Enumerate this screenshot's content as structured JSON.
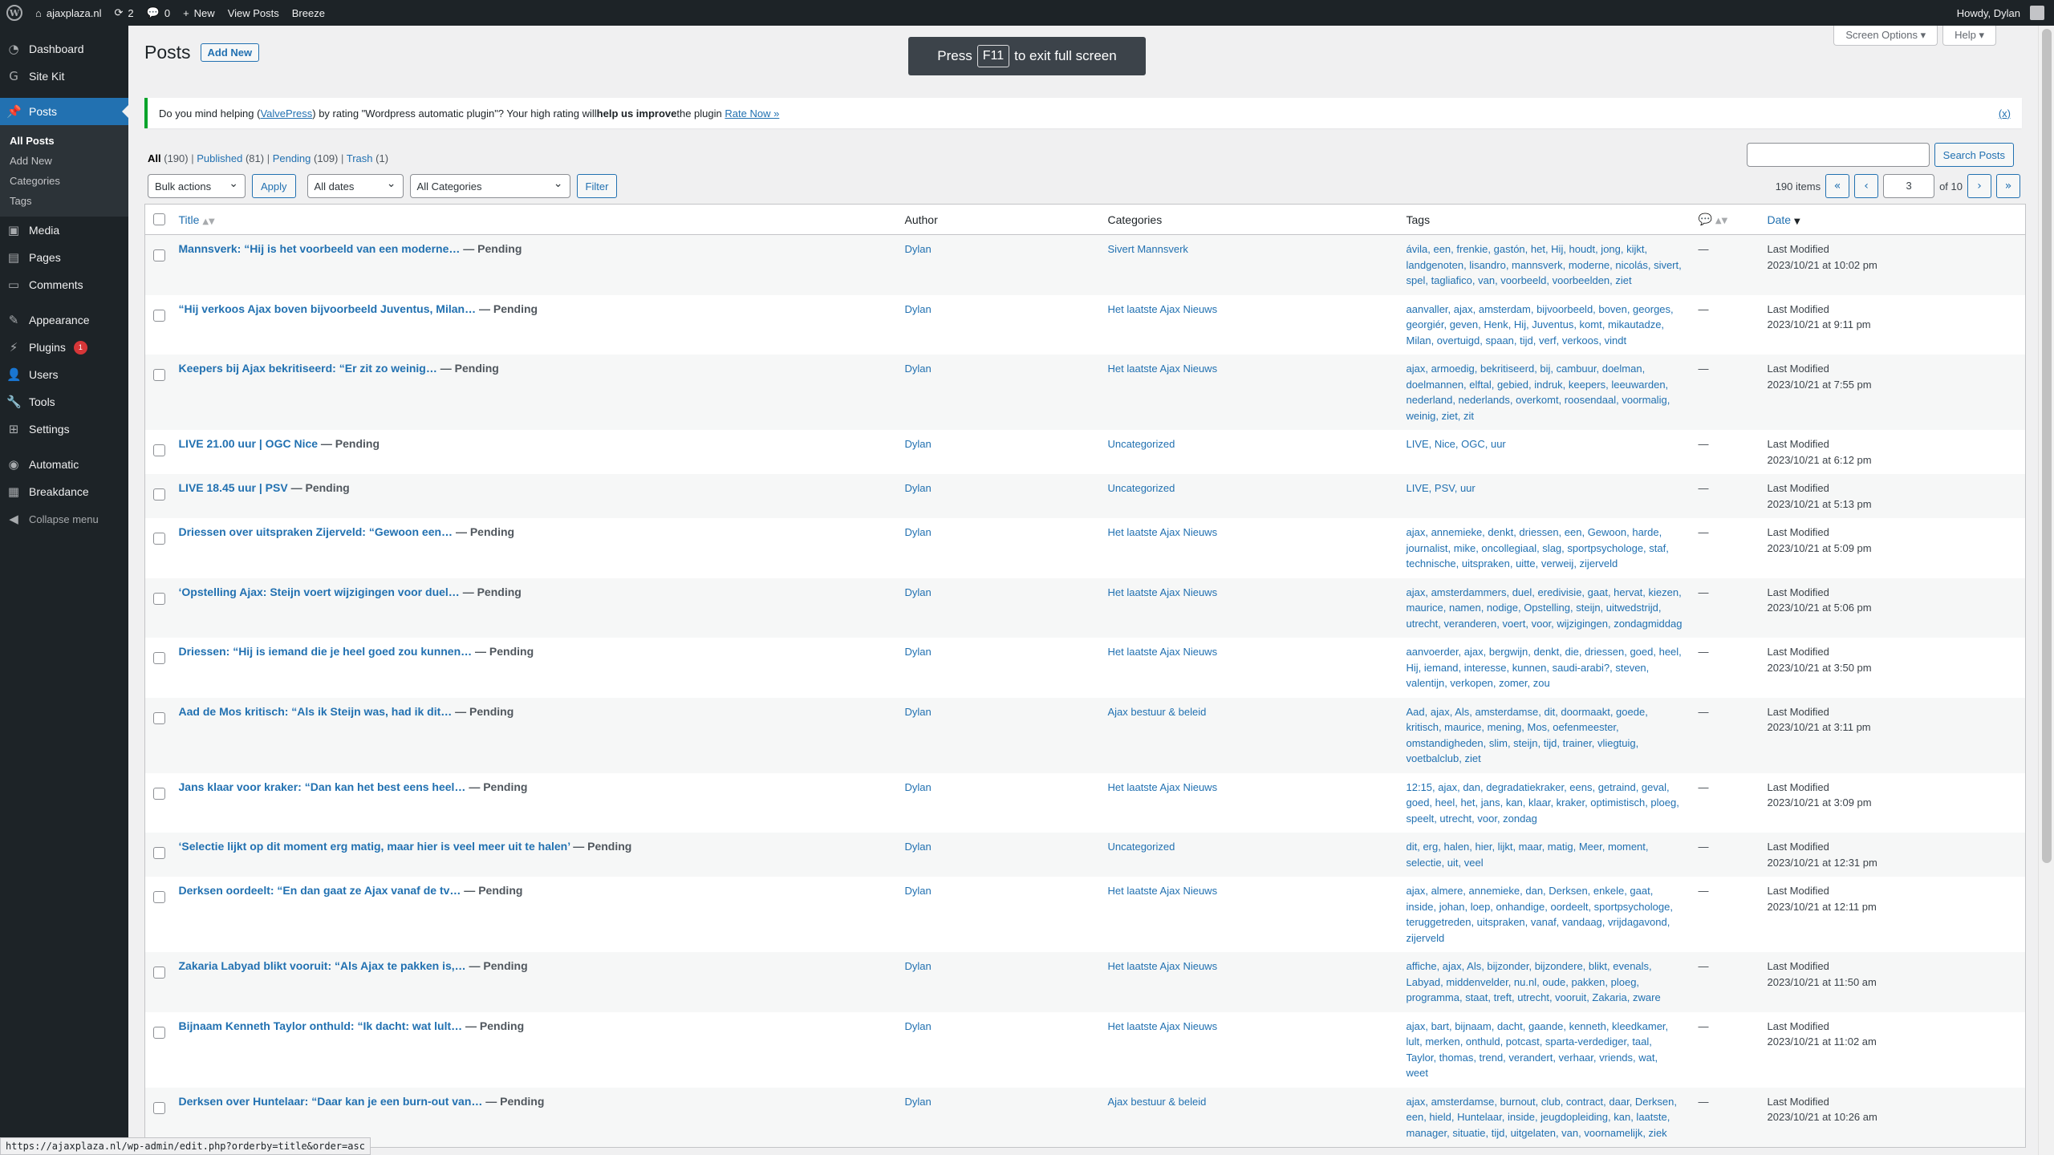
{
  "adminbar": {
    "site": "ajaxplaza.nl",
    "updates": "2",
    "comments": "0",
    "new": "New",
    "view_posts": "View Posts",
    "breeze": "Breeze",
    "howdy": "Howdy, Dylan"
  },
  "menu": {
    "dashboard": "Dashboard",
    "sitekit": "Site Kit",
    "posts": "Posts",
    "sub_all": "All Posts",
    "sub_add": "Add New",
    "sub_cats": "Categories",
    "sub_tags": "Tags",
    "media": "Media",
    "pages": "Pages",
    "comments": "Comments",
    "appearance": "Appearance",
    "plugins": "Plugins",
    "plugins_badge": "1",
    "users": "Users",
    "tools": "Tools",
    "settings": "Settings",
    "automatic": "Automatic",
    "breakdance": "Breakdance",
    "collapse": "Collapse menu"
  },
  "screen_options": "Screen Options ▾",
  "help": "Help ▾",
  "page_title": "Posts",
  "add_new": "Add New",
  "f11": {
    "press": "Press",
    "key": "F11",
    "rest": "to exit full screen"
  },
  "notice": {
    "pre": "Do you mind helping (",
    "link": "ValvePress",
    "mid": ") by rating \"Wordpress automatic plugin\"? Your high rating will ",
    "bold": "help us improve",
    "post": " the plugin ",
    "rate": "Rate Now »",
    "dismiss": "(x)"
  },
  "views": {
    "all": "All",
    "all_c": "(190)",
    "pub": "Published",
    "pub_c": "(81)",
    "pend": "Pending",
    "pend_c": "(109)",
    "trash": "Trash",
    "trash_c": "(1)"
  },
  "search_button": "Search Posts",
  "filters": {
    "bulk": "Bulk actions",
    "apply": "Apply",
    "dates": "All dates",
    "cats": "All Categories",
    "filter": "Filter"
  },
  "pagination": {
    "items": "190 items",
    "first": "«",
    "prev": "‹",
    "current": "3",
    "of": "of 10",
    "next": "›",
    "last": "»"
  },
  "columns": {
    "title": "Title",
    "author": "Author",
    "categories": "Categories",
    "tags": "Tags",
    "date": "Date"
  },
  "posts": [
    {
      "title": "Mannsverk: “Hij is het voorbeeld van een moderne…",
      "state": " — Pending",
      "author": "Dylan",
      "category": "Sivert Mannsverk",
      "tags": "ávila, een, frenkie, gastón, het, Hij, houdt, jong, kijkt, landgenoten, lisandro, mannsverk, moderne, nicolás, sivert, spel, tagliafico, van, voorbeeld, voorbeelden, ziet",
      "comments": "—",
      "date_label": "Last Modified",
      "date": "2023/10/21 at 10:02 pm"
    },
    {
      "title": "“Hij verkoos Ajax boven bijvoorbeeld Juventus, Milan…",
      "state": " — Pending",
      "author": "Dylan",
      "category": "Het laatste Ajax Nieuws",
      "tags": "aanvaller, ajax, amsterdam, bijvoorbeeld, boven, georges, georgiér, geven, Henk, Hij, Juventus, komt, mikautadze, Milan, overtuigd, spaan, tijd, verf, verkoos, vindt",
      "comments": "—",
      "date_label": "Last Modified",
      "date": "2023/10/21 at 9:11 pm"
    },
    {
      "title": "Keepers bij Ajax bekritiseerd: “Er zit zo weinig…",
      "state": " — Pending",
      "author": "Dylan",
      "category": "Het laatste Ajax Nieuws",
      "tags": "ajax, armoedig, bekritiseerd, bij, cambuur, doelman, doelmannen, elftal, gebied, indruk, keepers, leeuwarden, nederland, nederlands, overkomt, roosendaal, voormalig, weinig, ziet, zit",
      "comments": "—",
      "date_label": "Last Modified",
      "date": "2023/10/21 at 7:55 pm"
    },
    {
      "title": "LIVE 21.00 uur | OGC Nice",
      "state": " — Pending",
      "author": "Dylan",
      "category": "Uncategorized",
      "tags": "LIVE, Nice, OGC, uur",
      "comments": "—",
      "date_label": "Last Modified",
      "date": "2023/10/21 at 6:12 pm"
    },
    {
      "title": "LIVE 18.45 uur | PSV",
      "state": " — Pending",
      "author": "Dylan",
      "category": "Uncategorized",
      "tags": "LIVE, PSV, uur",
      "comments": "—",
      "date_label": "Last Modified",
      "date": "2023/10/21 at 5:13 pm"
    },
    {
      "title": "Driessen over uitspraken Zijerveld: “Gewoon een…",
      "state": " — Pending",
      "author": "Dylan",
      "category": "Het laatste Ajax Nieuws",
      "tags": "ajax, annemieke, denkt, driessen, een, Gewoon, harde, journalist, mike, oncollegiaal, slag, sportpsychologe, staf, technische, uitspraken, uitte, verweij, zijerveld",
      "comments": "—",
      "date_label": "Last Modified",
      "date": "2023/10/21 at 5:09 pm"
    },
    {
      "title": "‘Opstelling Ajax: Steijn voert wijzigingen voor duel…",
      "state": " — Pending",
      "author": "Dylan",
      "category": "Het laatste Ajax Nieuws",
      "tags": "ajax, amsterdammers, duel, eredivisie, gaat, hervat, kiezen, maurice, namen, nodige, Opstelling, steijn, uitwedstrijd, utrecht, veranderen, voert, voor, wijzigingen, zondagmiddag",
      "comments": "—",
      "date_label": "Last Modified",
      "date": "2023/10/21 at 5:06 pm"
    },
    {
      "title": "Driessen: “Hij is iemand die je heel goed zou kunnen…",
      "state": " — Pending",
      "author": "Dylan",
      "category": "Het laatste Ajax Nieuws",
      "tags": "aanvoerder, ajax, bergwijn, denkt, die, driessen, goed, heel, Hij, iemand, interesse, kunnen, saudi-arabi?, steven, valentijn, verkopen, zomer, zou",
      "comments": "—",
      "date_label": "Last Modified",
      "date": "2023/10/21 at 3:50 pm"
    },
    {
      "title": "Aad de Mos kritisch: “Als ik Steijn was, had ik dit…",
      "state": " — Pending",
      "author": "Dylan",
      "category": "Ajax bestuur & beleid",
      "tags": "Aad, ajax, Als, amsterdamse, dit, doormaakt, goede, kritisch, maurice, mening, Mos, oefenmeester, omstandigheden, slim, steijn, tijd, trainer, vliegtuig, voetbalclub, ziet",
      "comments": "—",
      "date_label": "Last Modified",
      "date": "2023/10/21 at 3:11 pm"
    },
    {
      "title": "Jans klaar voor kraker: “Dan kan het best eens heel…",
      "state": " — Pending",
      "author": "Dylan",
      "category": "Het laatste Ajax Nieuws",
      "tags": "12:15, ajax, dan, degradatiekraker, eens, getraind, geval, goed, heel, het, jans, kan, klaar, kraker, optimistisch, ploeg, speelt, utrecht, voor, zondag",
      "comments": "—",
      "date_label": "Last Modified",
      "date": "2023/10/21 at 3:09 pm"
    },
    {
      "title": "‘Selectie lijkt op dit moment erg matig, maar hier is veel meer uit te halen’",
      "state": " — Pending",
      "author": "Dylan",
      "category": "Uncategorized",
      "tags": "dit, erg, halen, hier, lijkt, maar, matig, Meer, moment, selectie, uit, veel",
      "comments": "—",
      "date_label": "Last Modified",
      "date": "2023/10/21 at 12:31 pm"
    },
    {
      "title": "Derksen oordeelt: “En dan gaat ze Ajax vanaf de tv…",
      "state": " — Pending",
      "author": "Dylan",
      "category": "Het laatste Ajax Nieuws",
      "tags": "ajax, almere, annemieke, dan, Derksen, enkele, gaat, inside, johan, loep, onhandige, oordeelt, sportpsychologe, teruggetreden, uitspraken, vanaf, vandaag, vrijdagavond, zijerveld",
      "comments": "—",
      "date_label": "Last Modified",
      "date": "2023/10/21 at 12:11 pm"
    },
    {
      "title": "Zakaria Labyad blikt vooruit: “Als Ajax te pakken is,…",
      "state": " — Pending",
      "author": "Dylan",
      "category": "Het laatste Ajax Nieuws",
      "tags": "affiche, ajax, Als, bijzonder, bijzondere, blikt, evenals, Labyad, middenvelder, nu.nl, oude, pakken, ploeg, programma, staat, treft, utrecht, vooruit, Zakaria, zware",
      "comments": "—",
      "date_label": "Last Modified",
      "date": "2023/10/21 at 11:50 am"
    },
    {
      "title": "Bijnaam Kenneth Taylor onthuld: “Ik dacht: wat lult…",
      "state": " — Pending",
      "author": "Dylan",
      "category": "Het laatste Ajax Nieuws",
      "tags": "ajax, bart, bijnaam, dacht, gaande, kenneth, kleedkamer, lult, merken, onthuld, potcast, sparta-verdediger, taal, Taylor, thomas, trend, verandert, verhaar, vriends, wat, weet",
      "comments": "—",
      "date_label": "Last Modified",
      "date": "2023/10/21 at 11:02 am"
    },
    {
      "title": "Derksen over Huntelaar: “Daar kan je een burn-out van…",
      "state": " — Pending",
      "author": "Dylan",
      "category": "Ajax bestuur & beleid",
      "tags": "ajax, amsterdamse, burnout, club, contract, daar, Derksen, een, hield, Huntelaar, inside, jeugdopleiding, kan, laatste, manager, situatie, tijd, uitgelaten, van, voornamelijk, ziek",
      "comments": "—",
      "date_label": "Last Modified",
      "date": "2023/10/21 at 10:26 am"
    }
  ],
  "status_url": "https://ajaxplaza.nl/wp-admin/edit.php?orderby=title&order=asc"
}
